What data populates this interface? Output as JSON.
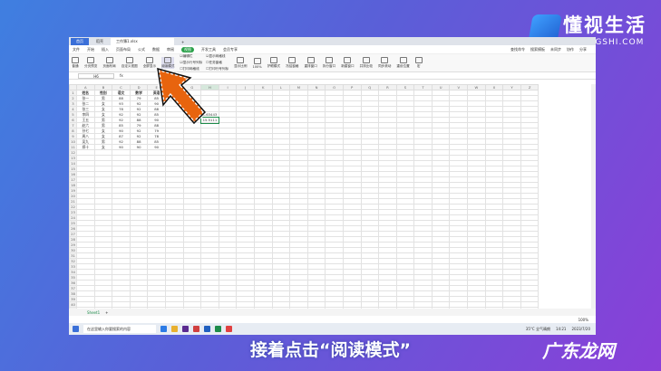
{
  "brand": {
    "name": "懂视生活",
    "domain": "DIDONGSHI.COM"
  },
  "caption": "接着点击“阅读模式”",
  "watermark": "广东龙网",
  "tabs": [
    "首页",
    "稻壳",
    "工作簿1.xlsx",
    "+"
  ],
  "menu": {
    "items": [
      "文件",
      "开始",
      "插入",
      "页面布局",
      "公式",
      "数据",
      "审阅",
      "视图",
      "开发工具",
      "会员专享",
      "查找命令",
      "搜索模板"
    ],
    "active": "视图",
    "right": [
      "未同步",
      "协作",
      "分享"
    ]
  },
  "ribbon": {
    "buttons": [
      "普通",
      "分页预览",
      "页面布局",
      "自定义视图",
      "全屏显示",
      "阅读模式"
    ],
    "checks": [
      "编辑栏",
      "显示网格线",
      "显示行号列标",
      "任务窗格",
      "打印网格线",
      "打印行号列标"
    ],
    "buttons2": [
      "显示比例",
      "100%",
      "护眼模式",
      "冻结窗格",
      "重排窗口",
      "拆分窗口",
      "新建窗口",
      "并排比较",
      "同步滚动",
      "重设位置",
      "宏"
    ]
  },
  "formula_bar": {
    "name_box": "H6",
    "fx": "fx"
  },
  "columns": [
    "A",
    "B",
    "C",
    "D",
    "E",
    "F",
    "G",
    "H",
    "I",
    "J",
    "K",
    "L",
    "M",
    "N",
    "O",
    "P",
    "Q",
    "R",
    "S",
    "T",
    "U",
    "V",
    "W",
    "X",
    "Y",
    "Z"
  ],
  "rows": [
    [
      "姓名",
      "性别",
      "语文",
      "数学",
      "英语",
      "",
      "",
      "",
      ""
    ],
    [
      "张一",
      "男",
      "88",
      "79",
      "85",
      "",
      "",
      "",
      ""
    ],
    [
      "张二",
      "女",
      "93",
      "92",
      "90",
      "",
      "",
      "",
      ""
    ],
    [
      "张三",
      "女",
      "78",
      "92",
      "88",
      "",
      "",
      "",
      ""
    ],
    [
      "李四",
      "女",
      "92",
      "92",
      "85",
      "",
      "标准差",
      "4.63443",
      ""
    ],
    [
      "王五",
      "男",
      "92",
      "88",
      "90",
      "",
      "",
      "15.5111",
      ""
    ],
    [
      "赵六",
      "男",
      "85",
      "79",
      "88",
      "",
      "",
      "",
      ""
    ],
    [
      "孙七",
      "女",
      "90",
      "92",
      "79",
      "",
      "",
      "",
      ""
    ],
    [
      "周八",
      "女",
      "87",
      "92",
      "78",
      "",
      "",
      "",
      ""
    ],
    [
      "吴九",
      "男",
      "92",
      "88",
      "85",
      "",
      "",
      "",
      ""
    ],
    [
      "郑十",
      "女",
      "90",
      "90",
      "90",
      "",
      "",
      "",
      ""
    ]
  ],
  "total_rows": 45,
  "sheet": "Sheet1",
  "status": {
    "zoom": "100%"
  },
  "taskbar": {
    "search_placeholder": "在这里输入你要搜索的内容",
    "weather": "35°C 全气晴朗",
    "time": "14:21",
    "date": "2023/7/20"
  }
}
